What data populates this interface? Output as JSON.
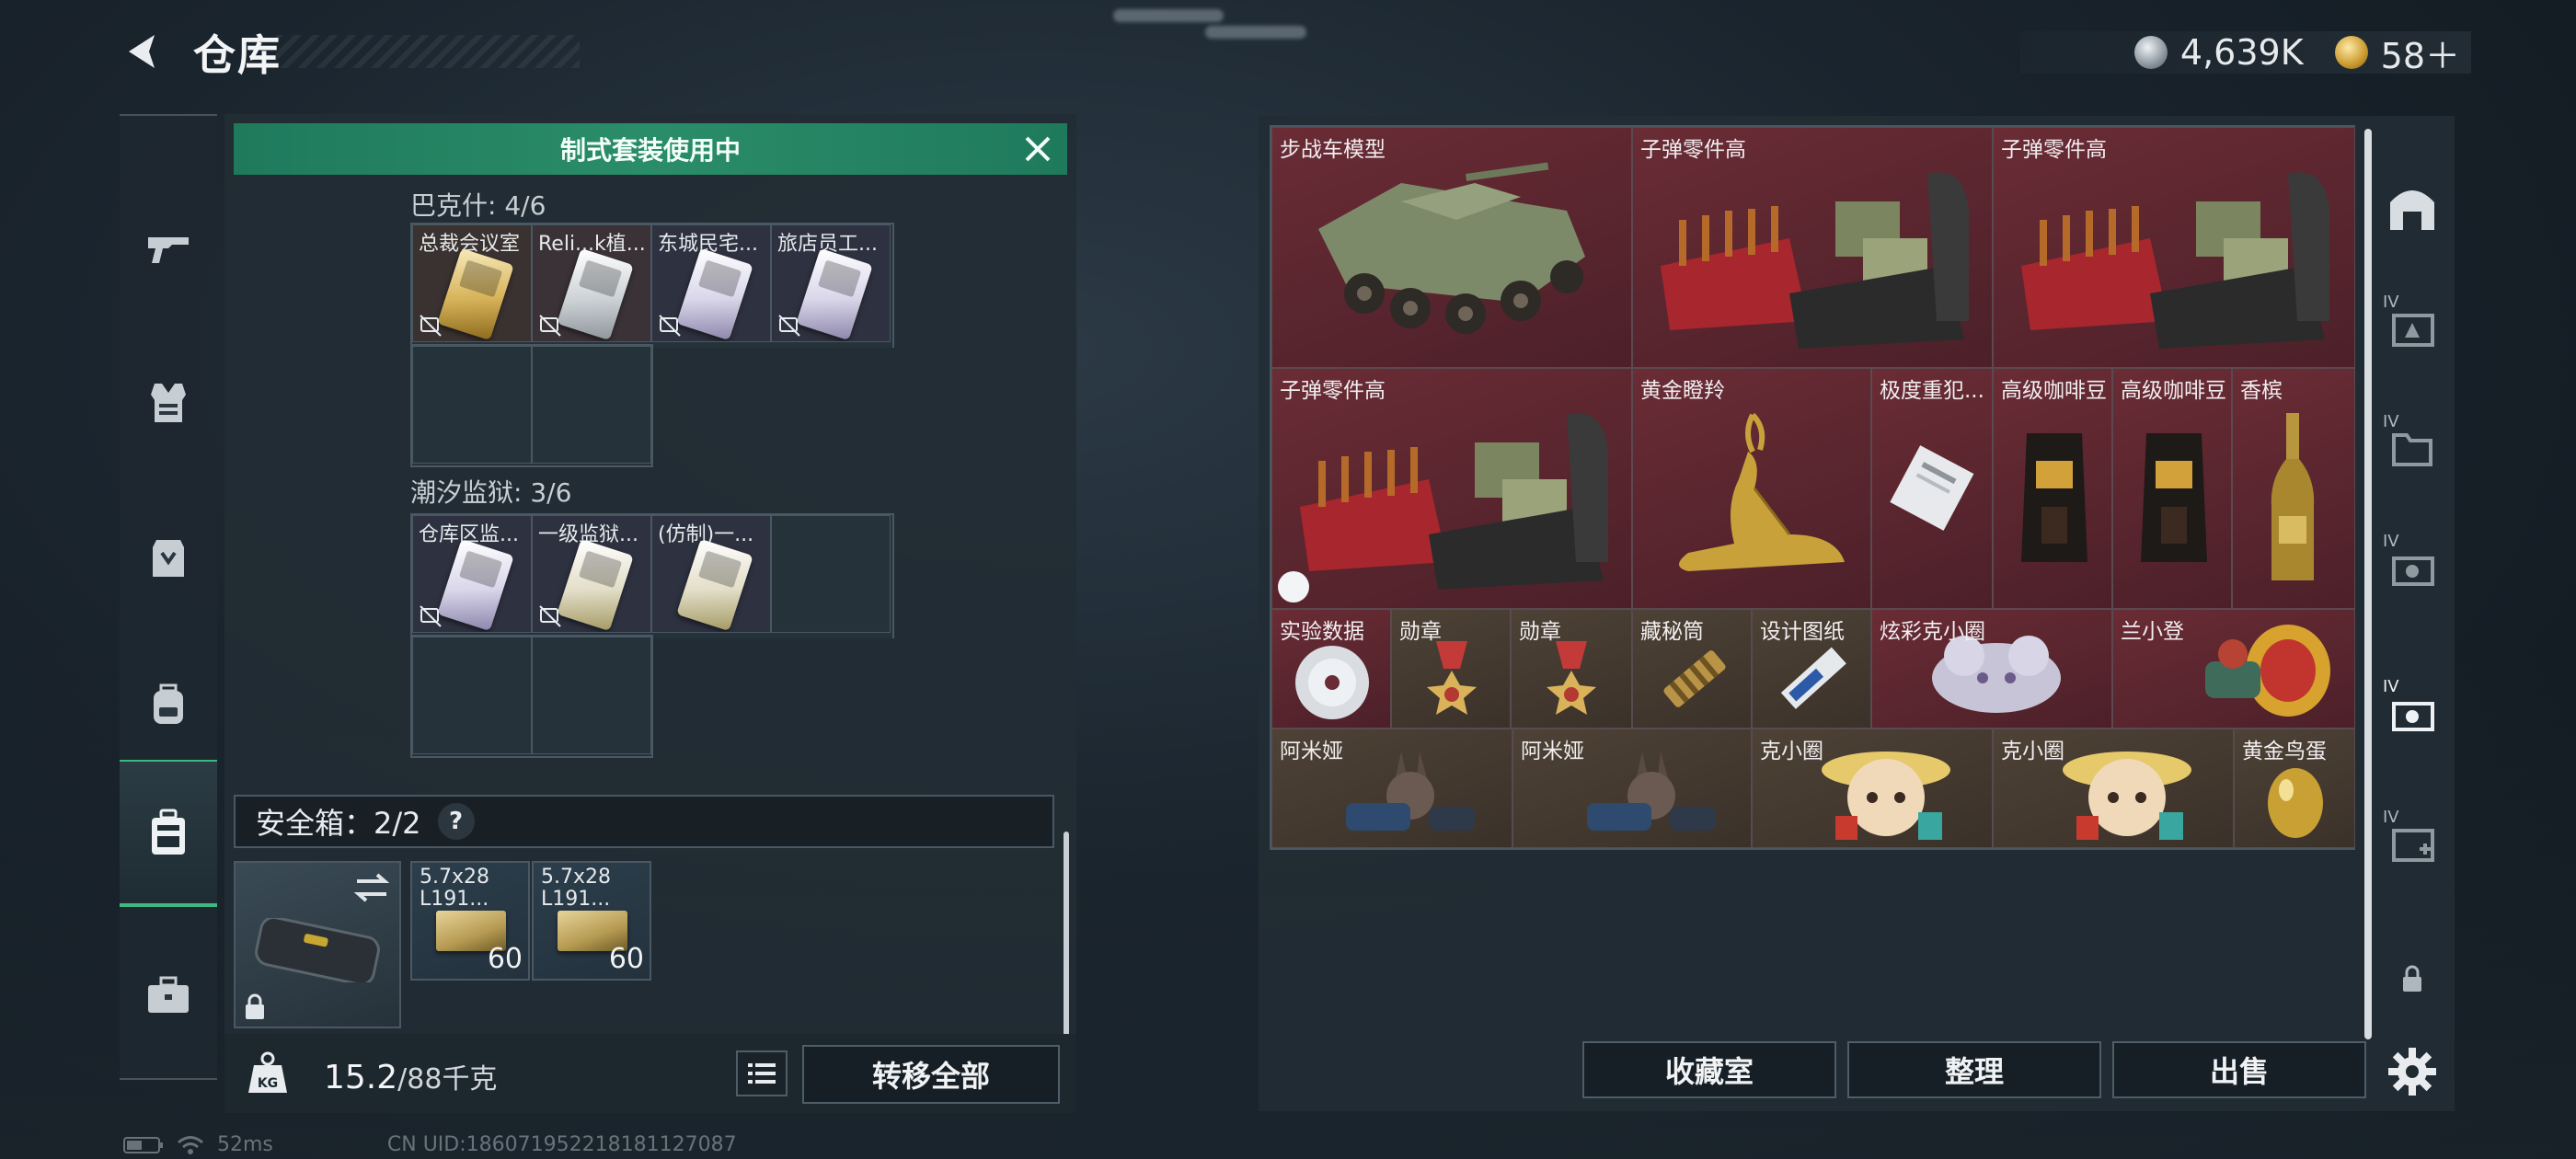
{
  "header": {
    "title": "仓库",
    "currency_silver": "4,639K",
    "currency_gold": "58＋"
  },
  "left_nav": {
    "items": [
      {
        "icon": "gun-icon"
      },
      {
        "icon": "vest-icon"
      },
      {
        "icon": "rig-icon"
      },
      {
        "icon": "backpack-icon"
      },
      {
        "icon": "safebox-icon",
        "active": true
      },
      {
        "icon": "briefcase-icon"
      }
    ]
  },
  "left_panel": {
    "banner": "制式套装使用中",
    "sections": [
      {
        "title": "巴克什: 4/6",
        "keys": [
          {
            "label": "总裁会议室",
            "card": "gold"
          },
          {
            "label": "Reli...k植...",
            "card": "silver"
          },
          {
            "label": "东城民宅...",
            "card": "purple"
          },
          {
            "label": "旅店员工...",
            "card": "purple"
          }
        ]
      },
      {
        "title": "潮汐监狱: 3/6",
        "keys": [
          {
            "label": "仓库区监...",
            "card": "purple"
          },
          {
            "label": "一级监狱...",
            "card": "yellow"
          },
          {
            "label": "(仿制)一...",
            "card": "yellow"
          }
        ]
      }
    ],
    "safe_box": {
      "label": "安全箱：2/2",
      "help": "?",
      "ammo": [
        {
          "name": "5.7x28",
          "sub": "L191...",
          "count": "60"
        },
        {
          "name": "5.7x28",
          "sub": "L191...",
          "count": "60"
        }
      ]
    },
    "weight": "15.2",
    "weight_max": "/88千克",
    "transfer_all": "转移全部"
  },
  "stash": {
    "items": [
      {
        "label": "步战车模型",
        "art": "ifv"
      },
      {
        "label": "子弹零件高",
        "art": "ammo-parts"
      },
      {
        "label": "子弹零件高",
        "art": "ammo-parts"
      },
      {
        "label": "子弹零件高",
        "art": "ammo-parts"
      },
      {
        "label": "黄金瞪羚",
        "art": "gazelle"
      },
      {
        "label": "极度重犯...",
        "art": "file"
      },
      {
        "label": "高级咖啡豆",
        "art": "coffee"
      },
      {
        "label": "高级咖啡豆",
        "art": "coffee"
      },
      {
        "label": "香槟",
        "art": "champagne"
      },
      {
        "label": "实验数据",
        "art": "disc"
      },
      {
        "label": "勋章",
        "art": "medal"
      },
      {
        "label": "勋章",
        "art": "medal"
      },
      {
        "label": "藏秘筒",
        "art": "cryptex"
      },
      {
        "label": "设计图纸",
        "art": "blueprint"
      },
      {
        "label": "炫彩克小圈",
        "art": "toy"
      },
      {
        "label": "兰小登",
        "art": "toy2"
      },
      {
        "label": "阿米娅",
        "art": "bunny"
      },
      {
        "label": "阿米娅",
        "art": "bunny"
      },
      {
        "label": "克小圈",
        "art": "doll"
      },
      {
        "label": "克小圈",
        "art": "doll"
      },
      {
        "label": "黄金鸟蛋",
        "art": "egg"
      }
    ],
    "buttons": {
      "collection": "收藏室",
      "sort": "整理",
      "sell": "出售"
    }
  },
  "right_nav": {
    "tags": [
      "IV",
      "IV",
      "IV",
      "IV",
      "IV"
    ]
  },
  "status": {
    "ping": "52ms",
    "uid": "CN UID:18607195221818112708​7"
  }
}
